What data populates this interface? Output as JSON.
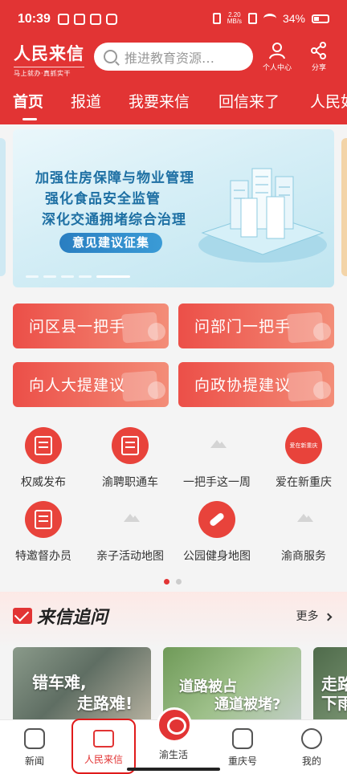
{
  "colors": {
    "brand_red": "#e23434",
    "accent_blue": "#1d6fa3"
  },
  "status_bar": {
    "time": "10:39",
    "speed_value": "2.20",
    "speed_unit": "MB/s",
    "battery": "34%"
  },
  "header": {
    "brand_name": "人民来信",
    "brand_slogan": "马上就办·真抓实干",
    "search_placeholder": "推进教育资源…",
    "profile_label": "个人中心",
    "share_label": "分享"
  },
  "tabs": [
    {
      "label": "首页"
    },
    {
      "label": "报道"
    },
    {
      "label": "我要来信"
    },
    {
      "label": "回信来了"
    },
    {
      "label": "人民如"
    }
  ],
  "banner": {
    "lines": [
      "加强住房保障与物业管理",
      "强化食品安全监管",
      "深化交通拥堵综合治理"
    ],
    "cta": "意见建议征集"
  },
  "quick_buttons": [
    {
      "label": "问区县一把手"
    },
    {
      "label": "问部门一把手"
    },
    {
      "label": "向人大提建议"
    },
    {
      "label": "向政协提建议"
    }
  ],
  "grid": [
    {
      "label": "权威发布",
      "icon": "book-icon"
    },
    {
      "label": "渝聘职通车",
      "icon": "job-icon"
    },
    {
      "label": "一把手这一周",
      "icon": "image-placeholder-icon"
    },
    {
      "label": "爱在新重庆",
      "icon": "love-chongqing-icon",
      "icon_text": "爱在新重庆"
    },
    {
      "label": "特邀督办员",
      "icon": "document-icon"
    },
    {
      "label": "亲子活动地图",
      "icon": "image-placeholder-icon"
    },
    {
      "label": "公园健身地图",
      "icon": "dumbbell-icon"
    },
    {
      "label": "渝商服务",
      "icon": "image-placeholder-icon"
    }
  ],
  "section": {
    "title": "来信追问",
    "more": "更多"
  },
  "cards": [
    {
      "line1": "错车难,",
      "line2": "走路难!"
    },
    {
      "line1": "道路被占",
      "line2": "通道被堵?"
    },
    {
      "line1": "走路",
      "line2": "下雨"
    }
  ],
  "tabbar": [
    {
      "label": "新闻",
      "icon": "house-icon"
    },
    {
      "label": "人民来信",
      "icon": "mail-icon"
    },
    {
      "label": "渝生活",
      "icon": "chat-bubble-icon"
    },
    {
      "label": "重庆号",
      "icon": "cube-icon"
    },
    {
      "label": "我的",
      "icon": "person-icon"
    }
  ]
}
